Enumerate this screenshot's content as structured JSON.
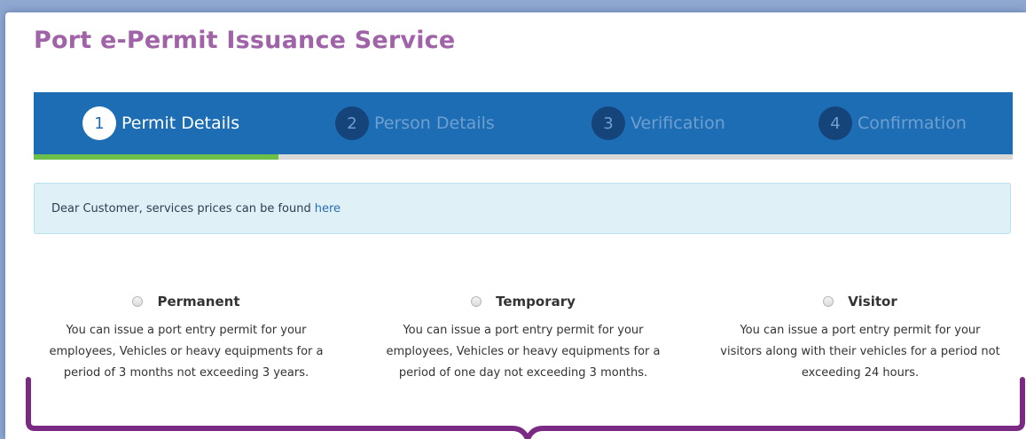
{
  "header": {
    "title": "Port e-Permit Issuance Service"
  },
  "steps": [
    {
      "num": "1",
      "label": "Permit Details",
      "state": "active"
    },
    {
      "num": "2",
      "label": "Person Details",
      "state": "inactive"
    },
    {
      "num": "3",
      "label": "Verification",
      "state": "inactive"
    },
    {
      "num": "4",
      "label": "Confirmation",
      "state": "inactive"
    }
  ],
  "progress": {
    "fraction": 0.25
  },
  "notice": {
    "text": "Dear Customer, services prices can be found",
    "link": "here"
  },
  "options": [
    {
      "title": "Permanent",
      "desc": [
        "You can issue a port entry permit for your",
        "employees, Vehicles or heavy equipments for a",
        "period of 3 months not exceeding 3 years."
      ]
    },
    {
      "title": "Temporary",
      "desc": [
        "You can issue a port entry permit for your",
        "employees, Vehicles or heavy equipments for a",
        "period of one day not exceeding 3 months."
      ]
    },
    {
      "title": "Visitor",
      "desc": [
        "You can issue a port entry permit for your",
        "visitors along with their vehicles for a period not",
        "exceeding 24 hours."
      ]
    }
  ],
  "colors": {
    "title": "#a063a8",
    "stepbar": "#1d6db4",
    "progress": "#6cc04a",
    "annotation": "#7a2a82"
  }
}
